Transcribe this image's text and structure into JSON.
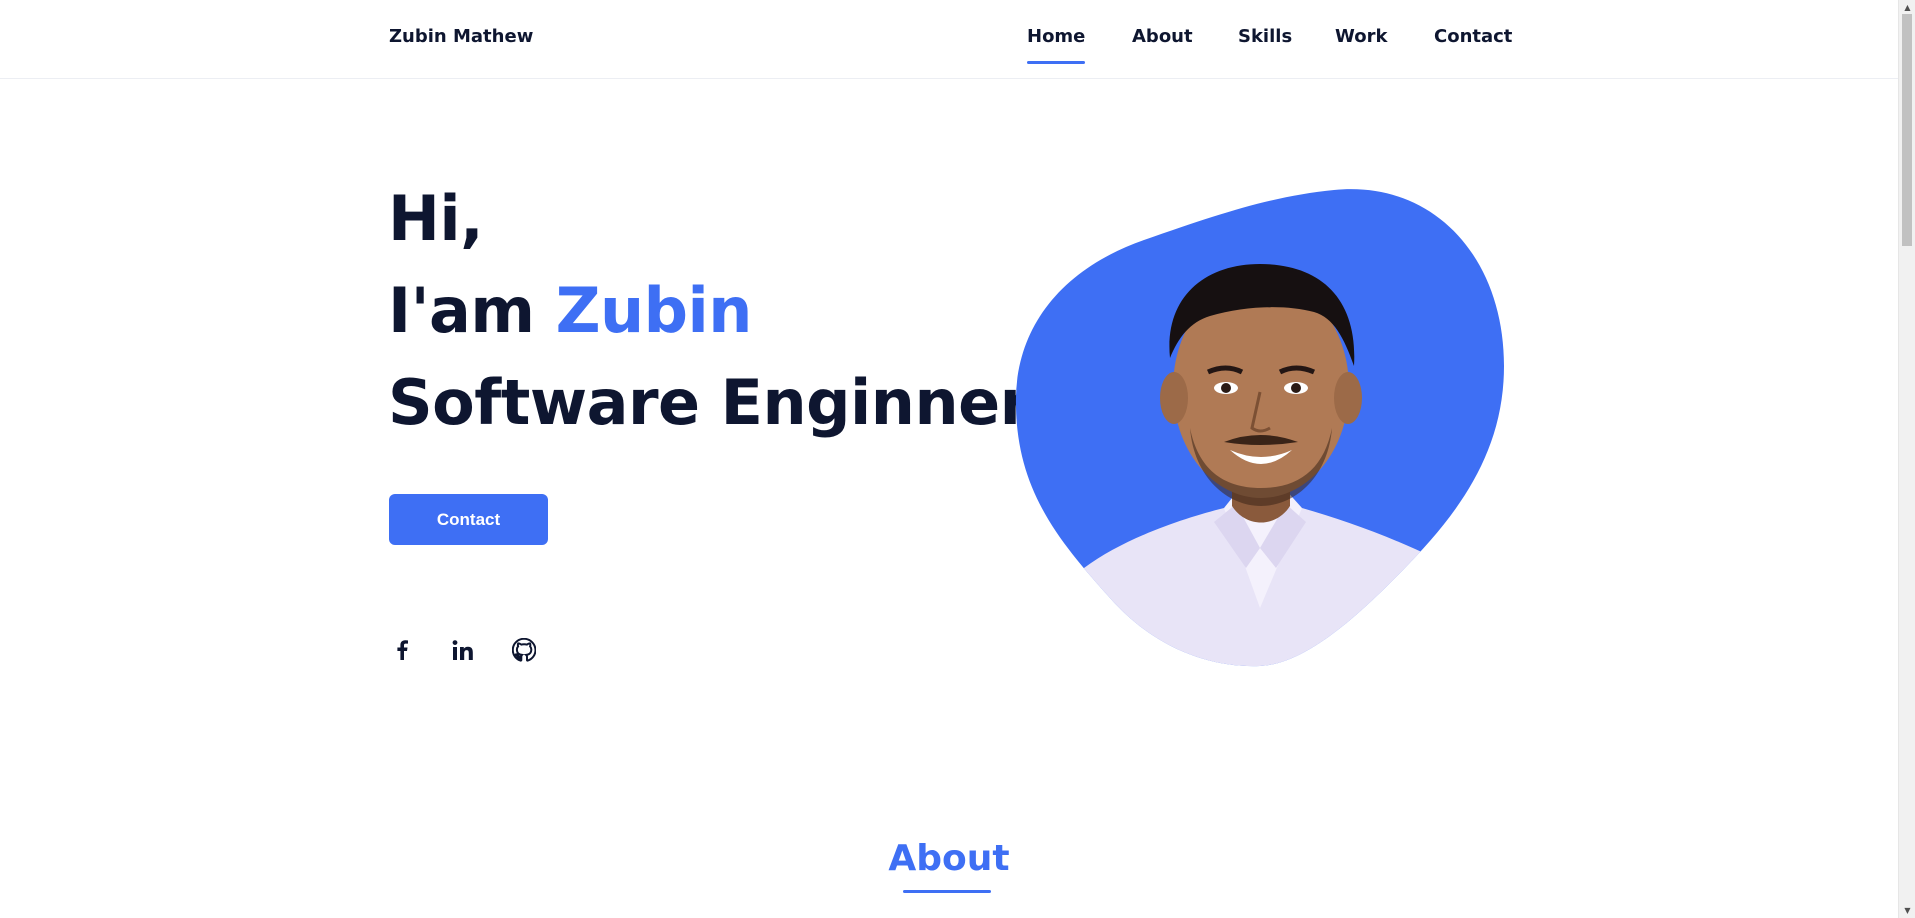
{
  "header": {
    "logo": "Zubin Mathew",
    "nav": {
      "home": "Home",
      "about": "About",
      "skills": "Skills",
      "work": "Work",
      "contact": "Contact"
    },
    "active_item": "Home"
  },
  "hero": {
    "greeting": "Hi,",
    "intro_prefix": "I'am ",
    "name": "Zubin",
    "role": "Software Enginner",
    "contact_button": "Contact",
    "social": [
      "facebook-icon",
      "linkedin-icon",
      "github-icon"
    ]
  },
  "about": {
    "title": "About"
  },
  "colors": {
    "accent": "#3e6ff4",
    "text": "#0e1630",
    "background": "#ffffff"
  }
}
